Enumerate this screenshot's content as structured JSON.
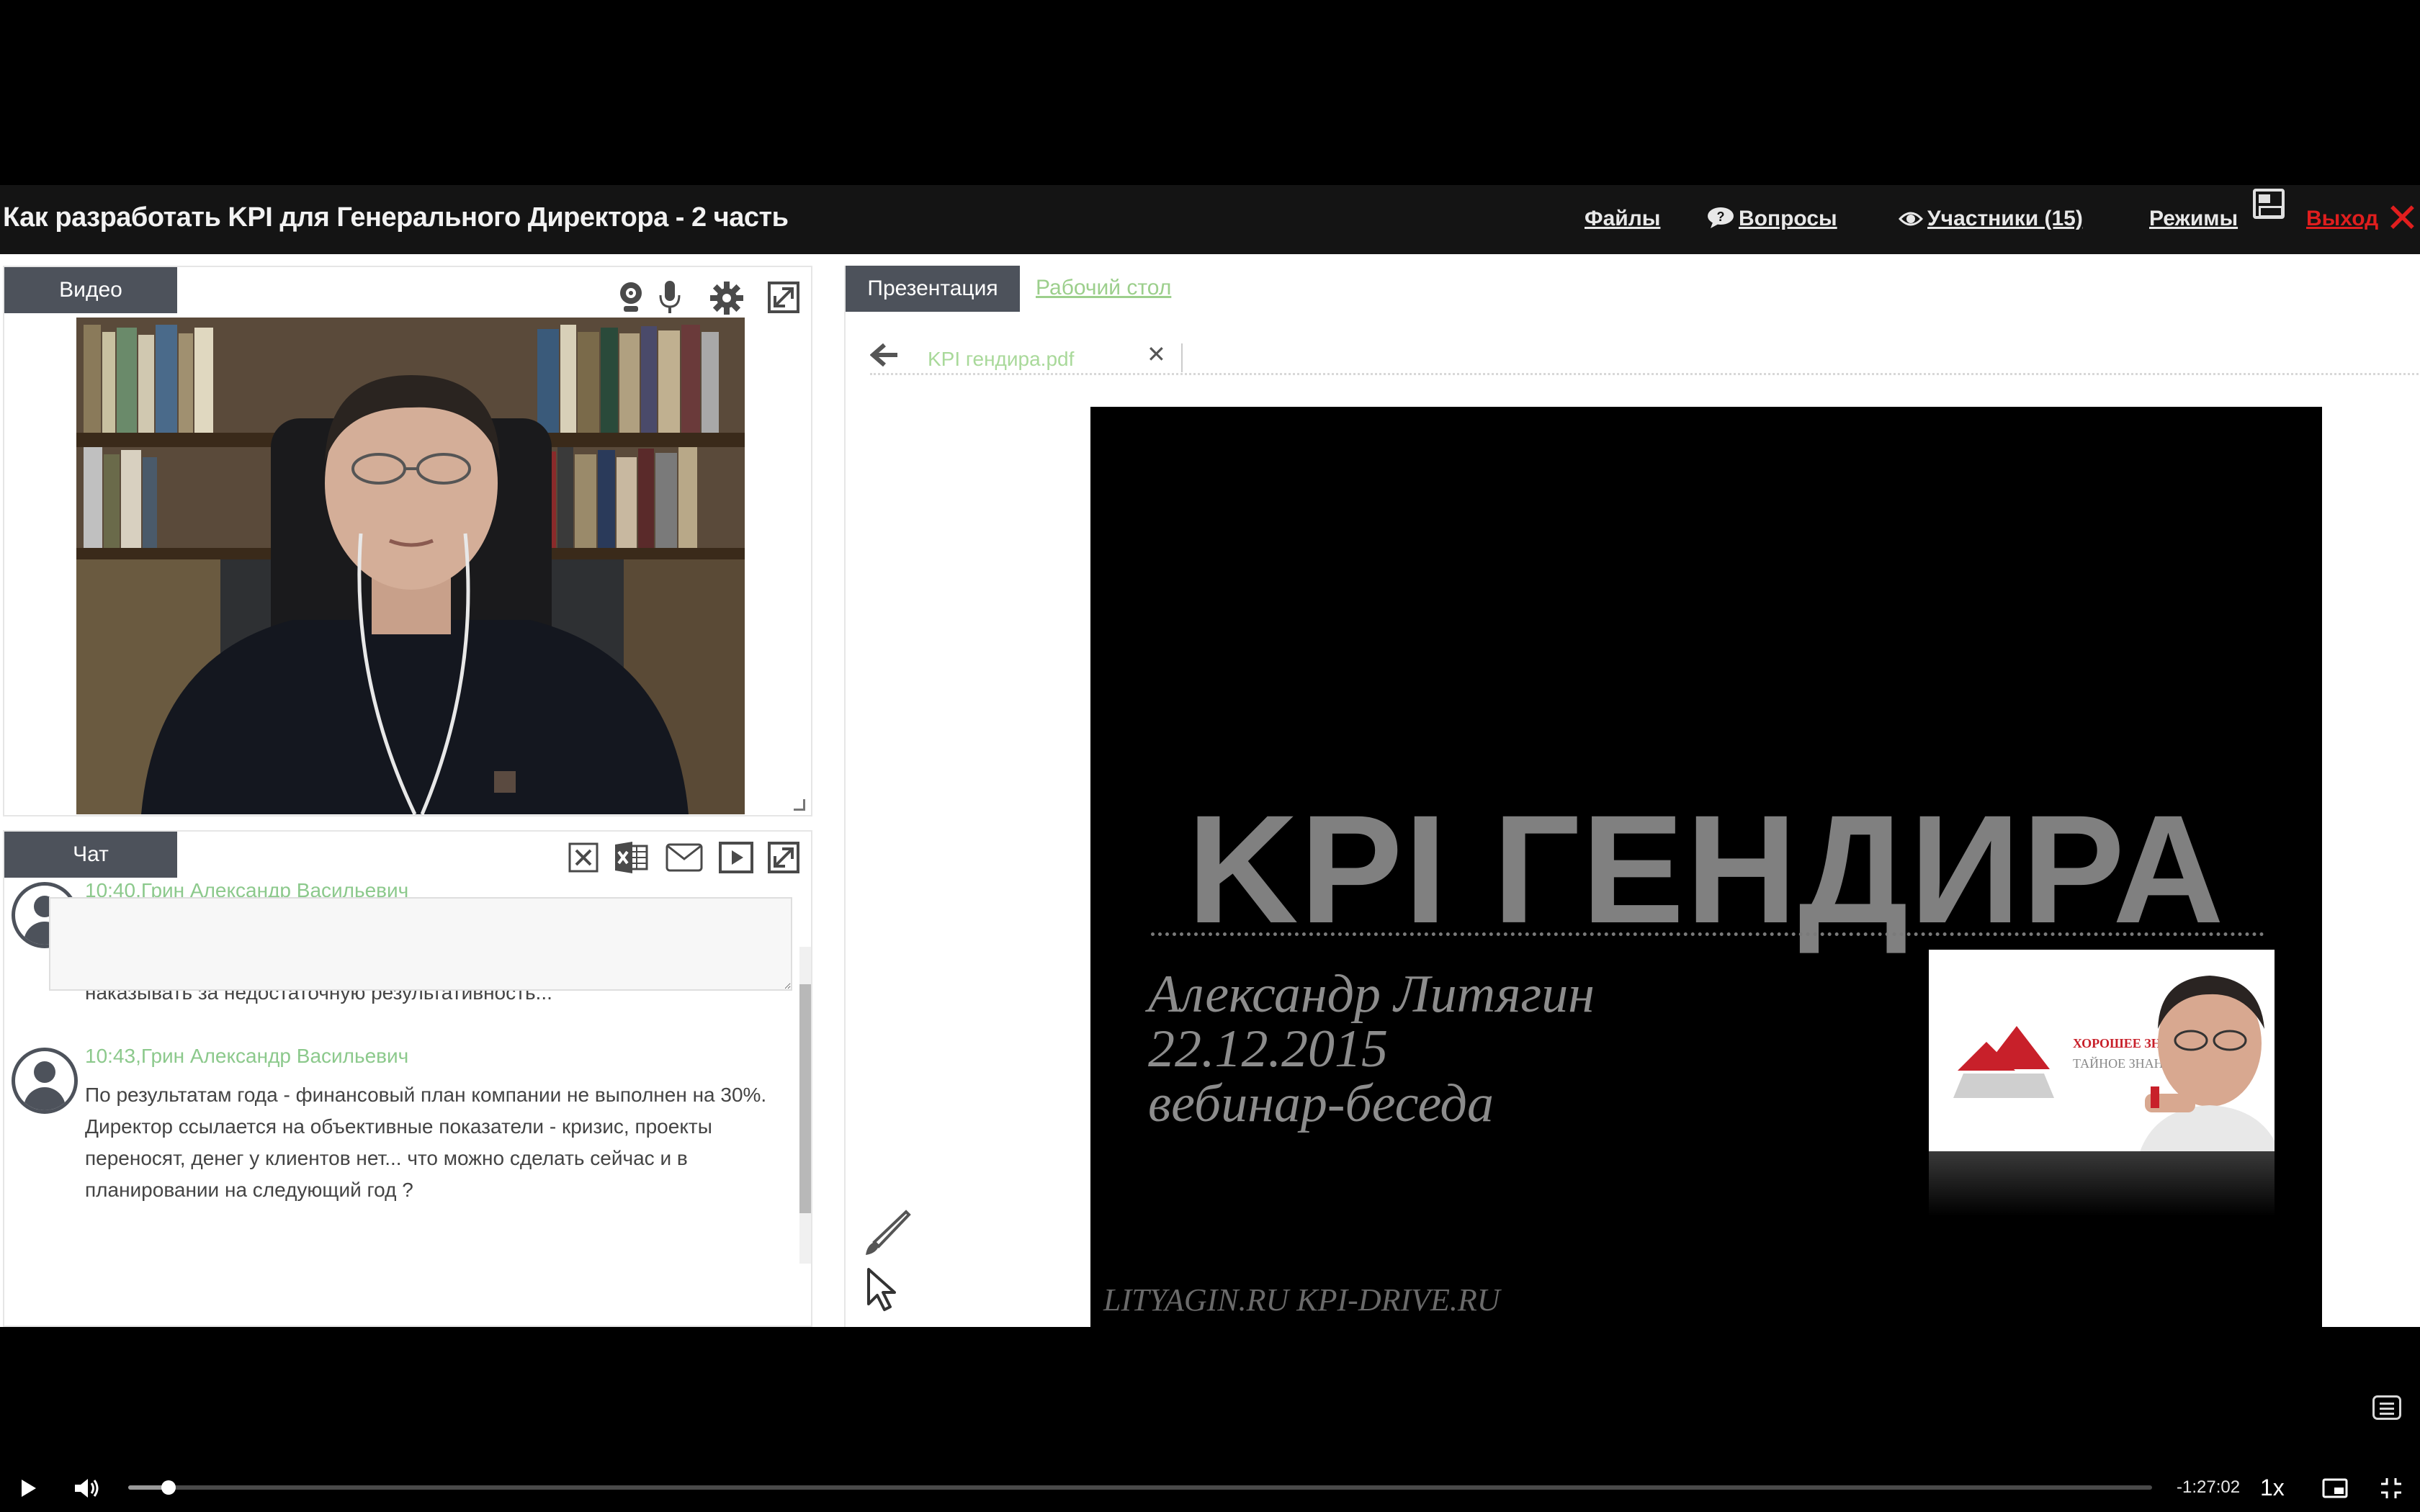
{
  "header": {
    "title": "Как разработать KPI для Генерального Директора - 2 часть",
    "nav": {
      "files": "Файлы",
      "questions": "Вопросы",
      "participants": "Участники (15)",
      "modes": "Режимы",
      "exit": "Выход"
    }
  },
  "video": {
    "tab_label": "Видео",
    "tools": [
      "webcam-icon",
      "microphone-icon",
      "settings-icon",
      "expand-icon"
    ]
  },
  "chat": {
    "tab_label": "Чат",
    "tools": [
      "clear-chat-icon",
      "excel-export-icon",
      "email-icon",
      "play-icon",
      "expand-icon"
    ],
    "messages": [
      {
        "time": "10:40",
        "author": "Грин Александр Васильевич",
        "text": "Что делать, если Генеральный директор ставит завышенные оценки своим подчиненным (руководителям отделов) ? Жалеет, не хочет наказывать за недостаточную результативность..."
      },
      {
        "time": "10:43",
        "author": "Грин Александр Васильевич",
        "text": "По результатам года - финансовый план компании не выполнен на 30%. Директор ссылается на объективные показатели - кризис, проекты переносят, денег у клиентов нет... что можно сделать сейчас и в планировании на следующий год ?"
      }
    ],
    "input_value": ""
  },
  "presentation": {
    "tab_label": "Презентация",
    "desktop_tab_label": "Рабочий стол",
    "file_name": "KPI гендира.pdf",
    "slide": {
      "title": "KPI ГЕНДИРА",
      "author": "Александр Литягин",
      "date": "22.12.2015",
      "subtitle": "вебинар-беседа",
      "footer": "LITYAGIN.RU  KPI-DRIVE.RU",
      "promo_line1": "ХОРОШЕЕ ЗНАНИЕ",
      "promo_line2": "ТАЙНОЕ ЗНАНИЕ"
    }
  },
  "player": {
    "time_remaining": "-1:27:02",
    "speed": "1x",
    "progress_fraction": 0.02,
    "colors": {
      "exit": "#e01e1e",
      "author": "#8cc98c",
      "tab": "#4d525b"
    }
  }
}
